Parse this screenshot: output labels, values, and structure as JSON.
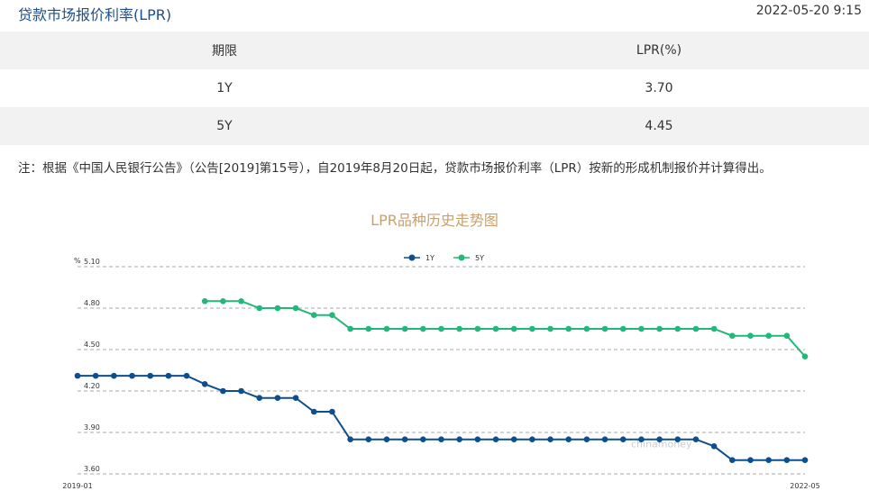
{
  "header": {
    "title": "贷款市场报价利率(LPR)",
    "timestamp": "2022-05-20 9:15"
  },
  "table": {
    "columns": [
      "期限",
      "LPR(%)"
    ],
    "rows": [
      {
        "term": "1Y",
        "rate": "3.70"
      },
      {
        "term": "5Y",
        "rate": "4.45"
      }
    ]
  },
  "note": "注：根据《中国人民银行公告》（公告[2019]第15号），自2019年8月20日起，贷款市场报价利率（LPR）按新的形成机制报价并计算得出。",
  "chart_data": {
    "type": "line",
    "title": "LPR品种历史走势图",
    "ylabel": "%",
    "ylim": [
      3.6,
      5.1
    ],
    "yticks": [
      "5.10",
      "4.80",
      "4.50",
      "4.20",
      "3.90",
      "3.60"
    ],
    "xtick_labels": [
      "2019-01",
      "2022-05"
    ],
    "grid": true,
    "grid_style": "dashed",
    "legend_position": "top-center",
    "watermark": "chinamoney",
    "colors": {
      "1Y": "#0d4e8f",
      "5Y": "#21b879"
    },
    "series": [
      {
        "name": "1Y",
        "values": [
          4.31,
          4.31,
          4.31,
          4.31,
          4.31,
          4.31,
          4.31,
          4.25,
          4.2,
          4.2,
          4.15,
          4.15,
          4.15,
          4.05,
          4.05,
          3.85,
          3.85,
          3.85,
          3.85,
          3.85,
          3.85,
          3.85,
          3.85,
          3.85,
          3.85,
          3.85,
          3.85,
          3.85,
          3.85,
          3.85,
          3.85,
          3.85,
          3.85,
          3.85,
          3.85,
          3.8,
          3.7,
          3.7,
          3.7,
          3.7,
          3.7
        ]
      },
      {
        "name": "5Y",
        "values": [
          null,
          null,
          null,
          null,
          null,
          null,
          null,
          4.85,
          4.85,
          4.85,
          4.8,
          4.8,
          4.8,
          4.75,
          4.75,
          4.65,
          4.65,
          4.65,
          4.65,
          4.65,
          4.65,
          4.65,
          4.65,
          4.65,
          4.65,
          4.65,
          4.65,
          4.65,
          4.65,
          4.65,
          4.65,
          4.65,
          4.65,
          4.65,
          4.65,
          4.65,
          4.6,
          4.6,
          4.6,
          4.6,
          4.45
        ]
      }
    ]
  }
}
